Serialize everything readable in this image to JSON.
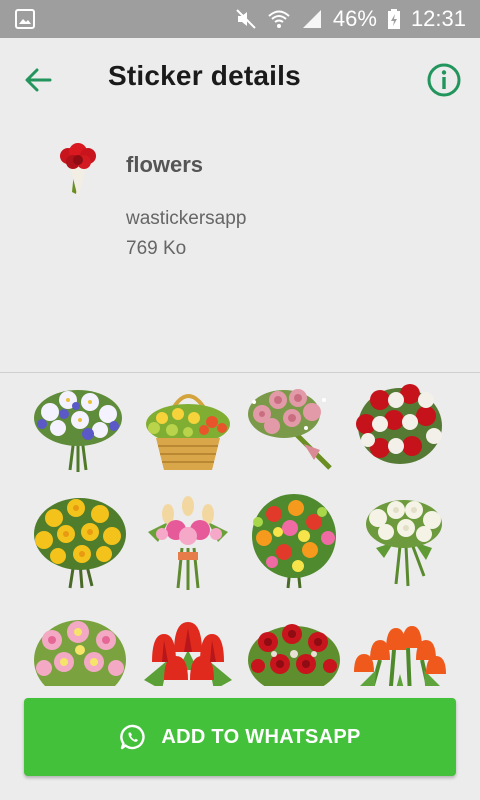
{
  "status_bar": {
    "battery": "46%",
    "time": "12:31",
    "icons": [
      "image-notification-icon",
      "mute-icon",
      "wifi-icon",
      "signal-icon",
      "battery-charging-icon"
    ]
  },
  "app_bar": {
    "title": "Sticker details",
    "back_icon": "arrow-back-icon",
    "info_icon": "info-icon",
    "accent": "#21955c"
  },
  "pack": {
    "name": "flowers",
    "publisher": "wastickersapp",
    "size": "769 Ko"
  },
  "stickers": [
    {
      "name": "lily-bouquet"
    },
    {
      "name": "basket-bouquet"
    },
    {
      "name": "pink-rose-bouquet"
    },
    {
      "name": "red-white-rose-bouquet"
    },
    {
      "name": "yellow-bouquet"
    },
    {
      "name": "tulip-mix-bouquet"
    },
    {
      "name": "colorful-round-bouquet"
    },
    {
      "name": "white-rose-bouquet"
    },
    {
      "name": "pink-bouquet"
    },
    {
      "name": "red-tulips"
    },
    {
      "name": "red-rose-arrangement"
    },
    {
      "name": "orange-tulips"
    }
  ],
  "add_button": {
    "label": "ADD TO WHATSAPP",
    "icon": "whatsapp-icon",
    "color": "#43c13b"
  }
}
